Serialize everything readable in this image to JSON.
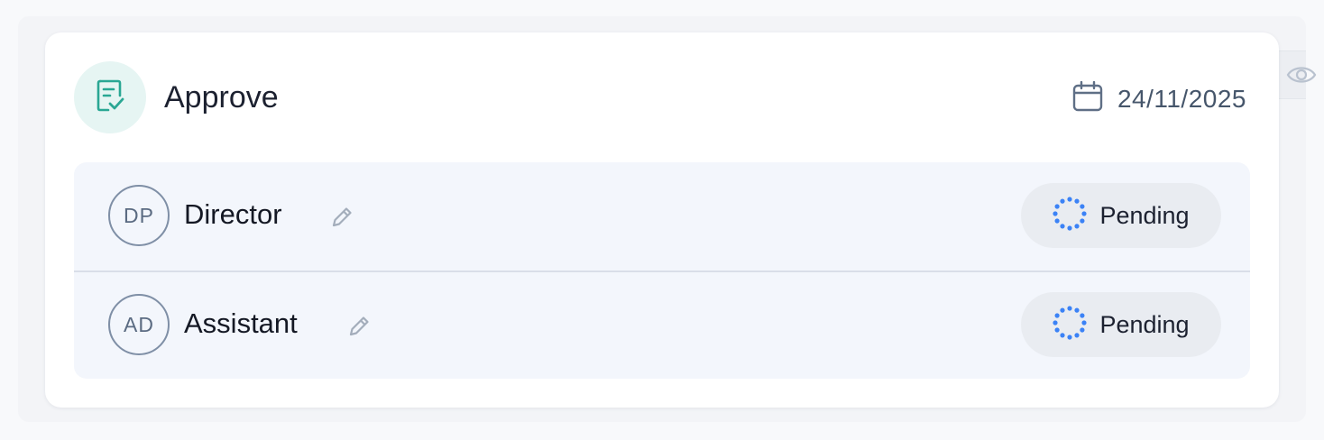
{
  "step": {
    "title": "Approve",
    "date": "24/11/2025"
  },
  "approvers": [
    {
      "initials": "DP",
      "name": "Director",
      "status": "Pending"
    },
    {
      "initials": "AD",
      "name": "Assistant",
      "status": "Pending"
    }
  ],
  "colors": {
    "accent": "#2aa794",
    "accent_bg": "#e6f5f3",
    "pending": "#3b82f6",
    "list_bg": "#f3f6fc"
  },
  "icons": {
    "header": "document-check-icon",
    "date": "calendar-icon",
    "edit": "pencil-icon",
    "status": "dotted-spinner-icon",
    "side": "eye-icon"
  }
}
